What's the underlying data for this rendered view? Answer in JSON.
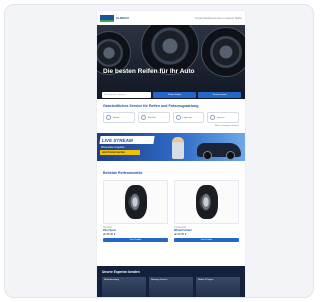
{
  "header": {
    "logo_text": "ALDEGO",
    "top_link": "Finde Reifenservice in deiner Nähe"
  },
  "hero": {
    "title": "Die besten Reifen für Ihr Auto",
    "search_placeholder": "Reifengröße eingeben",
    "button_1": "Reifen finden",
    "button_2": "Termin buchen"
  },
  "services": {
    "title": "Ganzheitliches Service für Reifen und Fahrzeugwartung",
    "items": [
      {
        "label": "Reifen",
        "icon": "tire-icon"
      },
      {
        "label": "Wechsel",
        "icon": "wrench-icon"
      },
      {
        "label": "Lagerung",
        "icon": "box-icon"
      },
      {
        "label": "Service",
        "icon": "car-icon"
      }
    ],
    "more_link": "Alle Leistungen ansehen"
  },
  "promo": {
    "title": "LIVE STREAM",
    "subtitle": "Winterreifen Angebote",
    "cta": "Jetzt Termin buchen"
  },
  "products": {
    "title": "Beliebte Reifenmodelle",
    "items": [
      {
        "brand": "Michelin",
        "name": "Pilot Sport",
        "price": "ab 89,90 €",
        "button": "Zum Produkt"
      },
      {
        "brand": "Continental",
        "name": "WinterContact",
        "price": "ab 94,50 €",
        "button": "Zum Produkt"
      }
    ]
  },
  "experts": {
    "title": "Unsere Experten beraten",
    "cards": [
      "Reifenberatung",
      "Montage Service",
      "Räder & Felgen"
    ]
  },
  "colors": {
    "brand_blue": "#1d4fa3",
    "button_blue": "#2367c9",
    "promo_yellow": "#f2c100",
    "footer_navy": "#13213d"
  }
}
